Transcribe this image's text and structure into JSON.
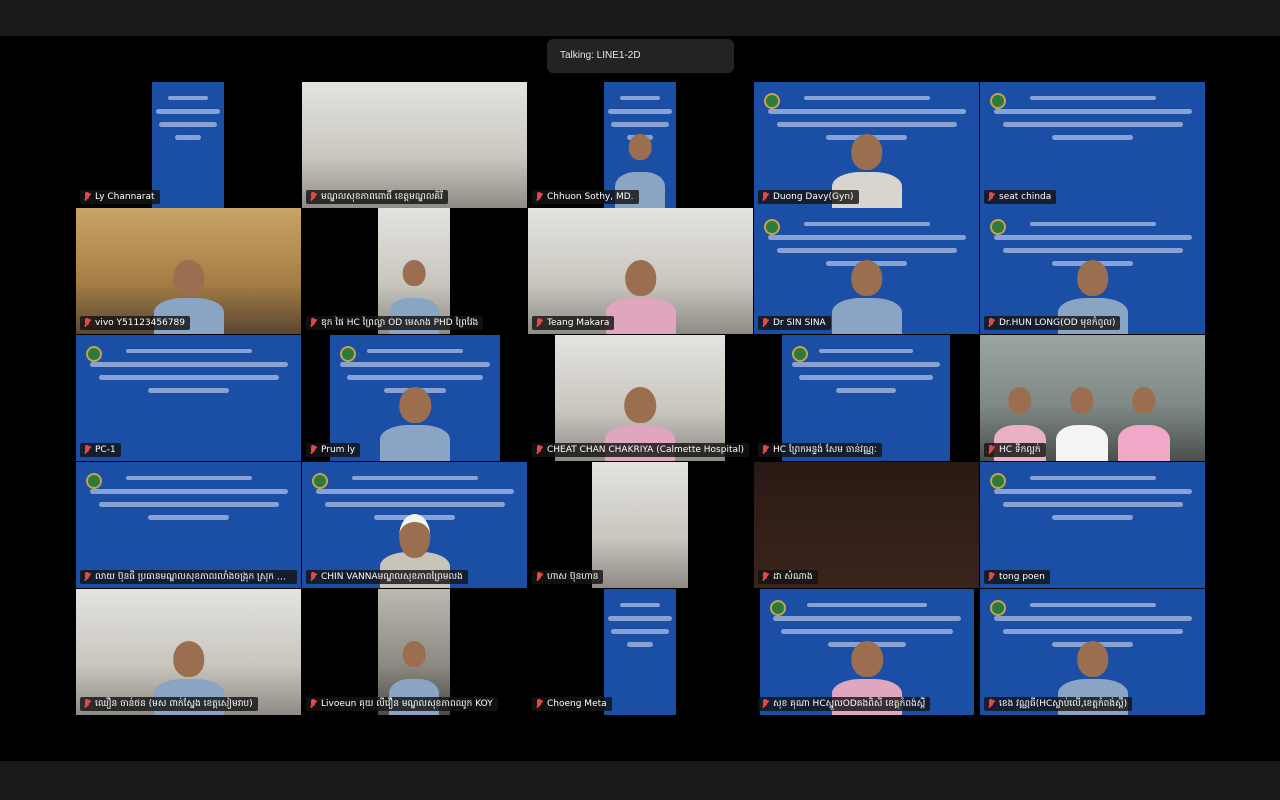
{
  "talking": "Talking: LINE1-2D",
  "colors": {
    "slide_blue": "#1b4fa5",
    "muted_mic": "#e54848"
  },
  "participants": [
    "Ly Channarat",
    "មណ្ឌលសុខភាពពោធិ៍ ខេត្តមណ្ឌលគិរី",
    "Chhuon Sothy, MD.",
    "Duong Davy(Gyn)",
    "seat chinda",
    "vivo Y51123456789",
    "ឌុក ផៃ HC ព្រៃល្វា OD មេសាង PHD ព្រៃវែង",
    "Teang Makara",
    "Dr SIN SINA",
    "Dr.HUN LONG(OD មុខកំពូល)",
    "PC-1",
    "Prum ly",
    "CHEAT CHAN CHAKRIYA (Calmette Hospital)",
    "HC ព្រែកអន្ទង់ សែម ចាន់វណ្ណៈ",
    "HC ទឹកល្អក់",
    "លាយ ប៊ុនធី ប្រធានមណ្ឌលសុខភាពរលាំងចង្រុក ស្រុក ស៊ ...",
    "CHIN VANNAមណ្ឌលសុខភាពព្រៃមលង",
    "ហាស ប៊ុនហាន",
    "ដា សំណាង",
    "tong poen",
    "ឈឿន ចាន់ថន (មស ពាក់ស្នែង ខេត្តសៀមរាប)",
    "Livoeun គុយ លីវឿន មណ្ឌលសុខភាពឈូក KOY",
    "Choeng Meta",
    "សុខ គុណា HCស្នួលODគងពិសី ខេត្តកំពង់ស្ពឺ",
    "ខេង វណ្ណធី(HCស្លាប់លើ,ខេត្តកំពង់ស្ពឺ)"
  ]
}
